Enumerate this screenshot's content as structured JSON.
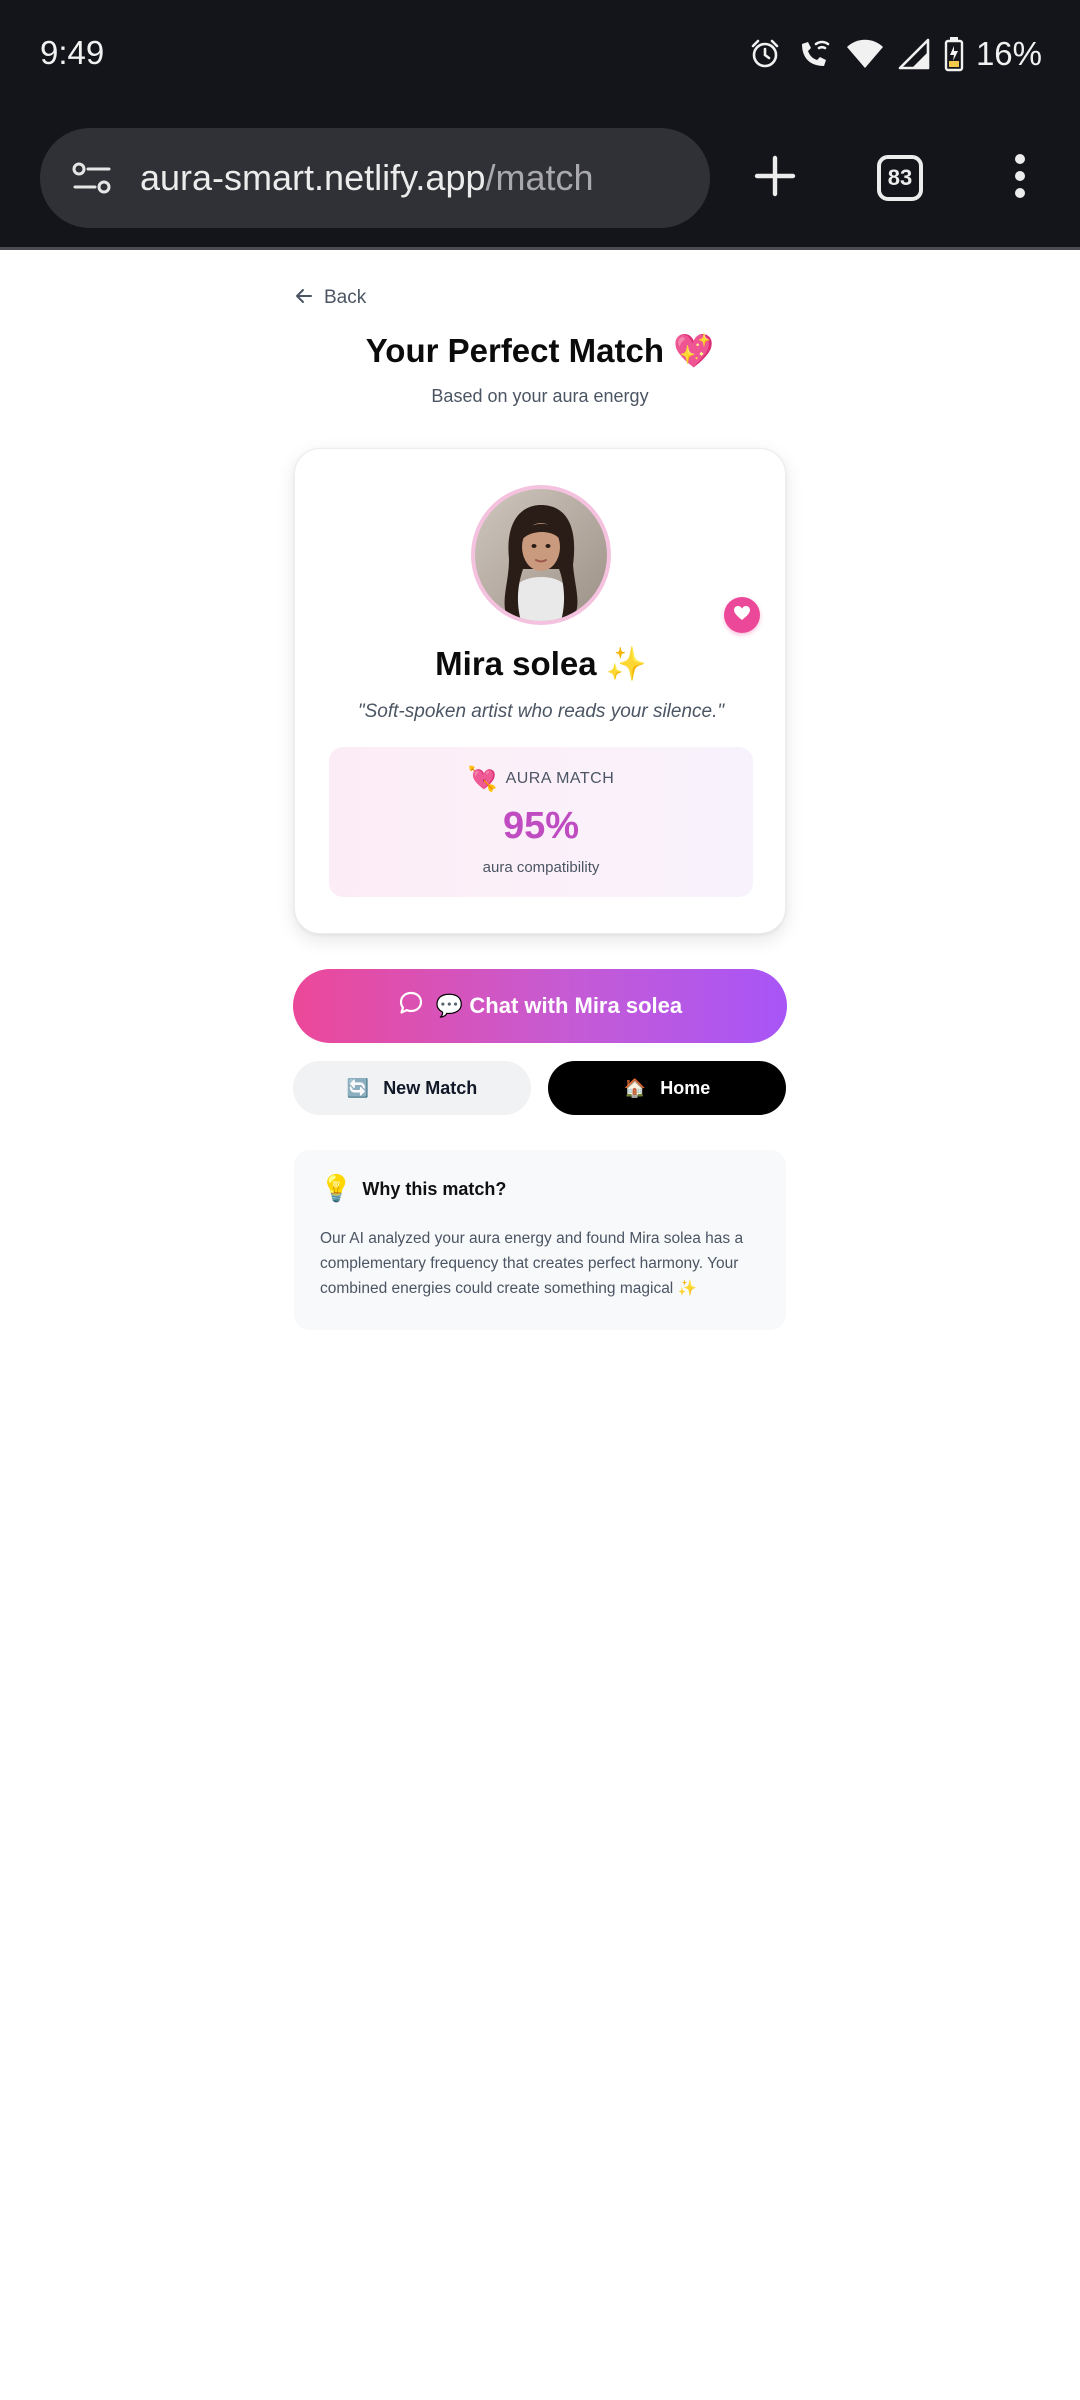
{
  "status_bar": {
    "time": "9:49",
    "battery_percent": "16%"
  },
  "browser": {
    "url_host": "aura-smart.netlify.app",
    "url_path": "/match",
    "tab_count": "83"
  },
  "page": {
    "back_label": "Back",
    "title": "Your Perfect Match 💖",
    "subtitle": "Based on your aura energy"
  },
  "match": {
    "name": "Mira solea ✨",
    "quote": "\"Soft-spoken artist who reads your silence.\"",
    "aura_emoji": "💘",
    "aura_label": "AURA MATCH",
    "aura_percent": "95%",
    "aura_caption": "aura compatibility"
  },
  "actions": {
    "chat_label": "💬 Chat with Mira solea",
    "new_match_emoji": "🔄",
    "new_match_label": "New Match",
    "home_emoji": "🏠",
    "home_label": "Home"
  },
  "why": {
    "emoji": "💡",
    "title": "Why this match?",
    "text": "Our AI analyzed your aura energy and found Mira solea has a complementary frequency that creates perfect harmony. Your combined energies could create something magical ✨"
  },
  "colors": {
    "accent_pink": "#ec4899",
    "accent_purple": "#a855f7",
    "percent_color": "#c04cc2",
    "chrome_bg": "#14151a"
  },
  "icons": {
    "status": [
      "alarm-icon",
      "wifi-calling-icon",
      "wifi-icon",
      "signal-icon",
      "battery-icon"
    ],
    "browser": [
      "site-settings-icon",
      "new-tab-icon",
      "tab-switcher-icon",
      "overflow-menu-icon"
    ],
    "page": [
      "arrow-left-icon",
      "heart-icon",
      "chat-bubble-icon"
    ]
  }
}
